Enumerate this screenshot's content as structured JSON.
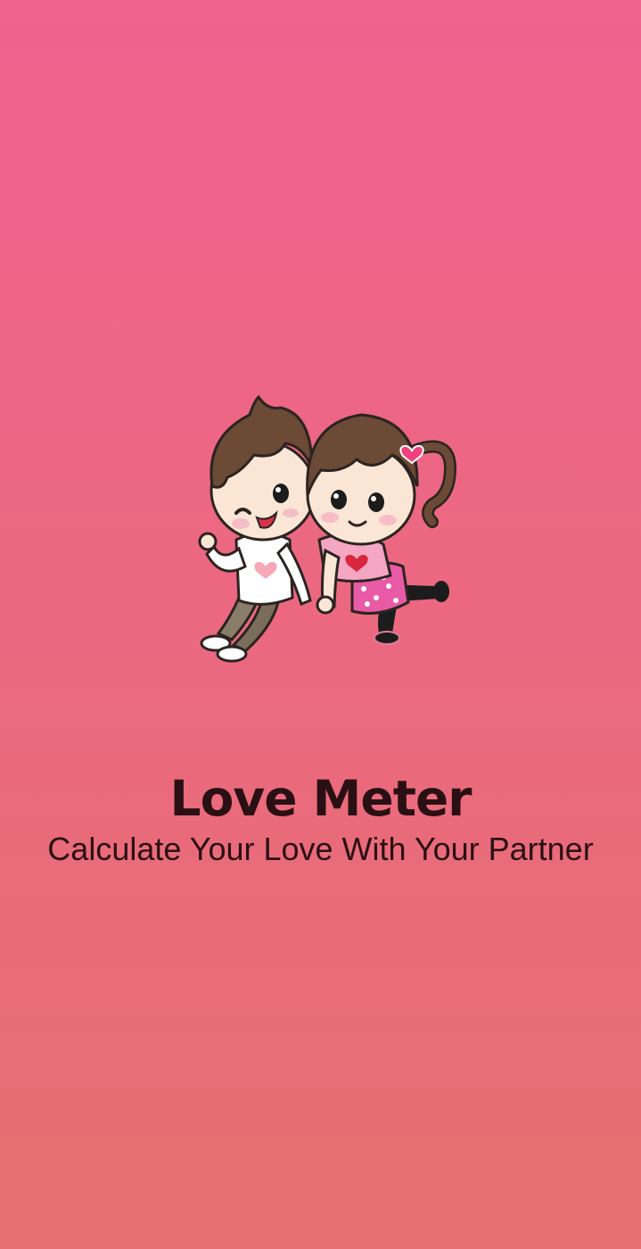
{
  "splash": {
    "title": "Love Meter",
    "subtitle": "Calculate Your Love With Your Partner",
    "illustration_icon": "cartoon-couple-icon"
  },
  "colors": {
    "background_top": "#f0628f",
    "background_bottom": "#e5706f",
    "text": "#2a1014"
  }
}
